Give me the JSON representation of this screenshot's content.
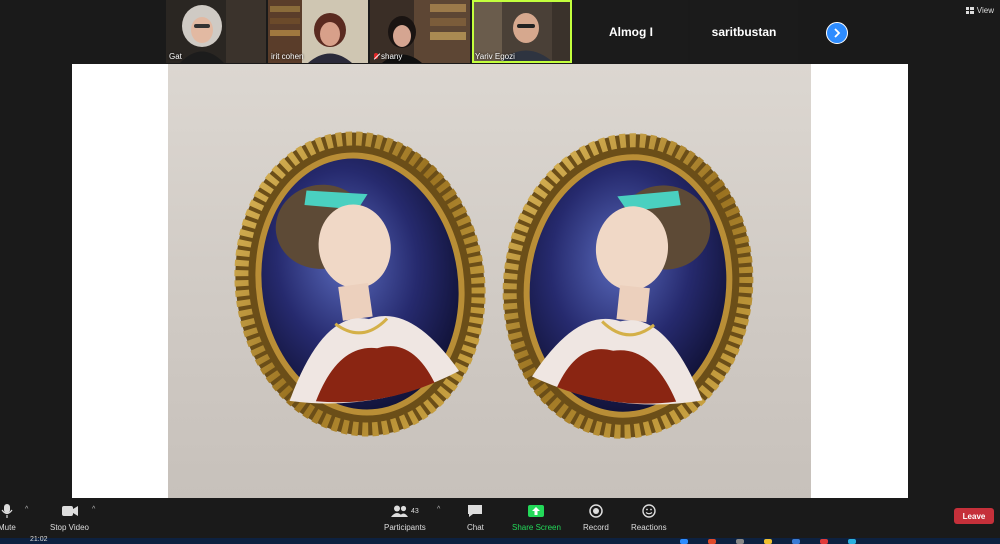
{
  "participants": [
    {
      "name": "Gat",
      "muted": false,
      "video": true
    },
    {
      "name": "irit cohen",
      "muted": false,
      "video": true
    },
    {
      "name": "shany",
      "muted": true,
      "video": true
    },
    {
      "name": "Yariv Egozi",
      "muted": false,
      "video": true,
      "active": true
    },
    {
      "name": "Almog I",
      "muted": false,
      "video": false
    },
    {
      "name": "saritbustan",
      "muted": true,
      "video": false
    }
  ],
  "view_label": "View",
  "toolbar": {
    "mute": "Mute",
    "stop_video": "Stop Video",
    "participants": "Participants",
    "participants_count": "43",
    "chat": "Chat",
    "share_screen": "Share Screen",
    "record": "Record",
    "reactions": "Reactions",
    "leave": "Leave"
  },
  "taskbar": {
    "time": "21:02"
  },
  "colors": {
    "accent_blue": "#2d8cff",
    "share_green": "#23d959",
    "leave_red": "#c5303a",
    "active_speaker": "#c3ff3d"
  },
  "shared_image": {
    "subject": "pair of oval enamel portrait earrings in gold frames"
  }
}
